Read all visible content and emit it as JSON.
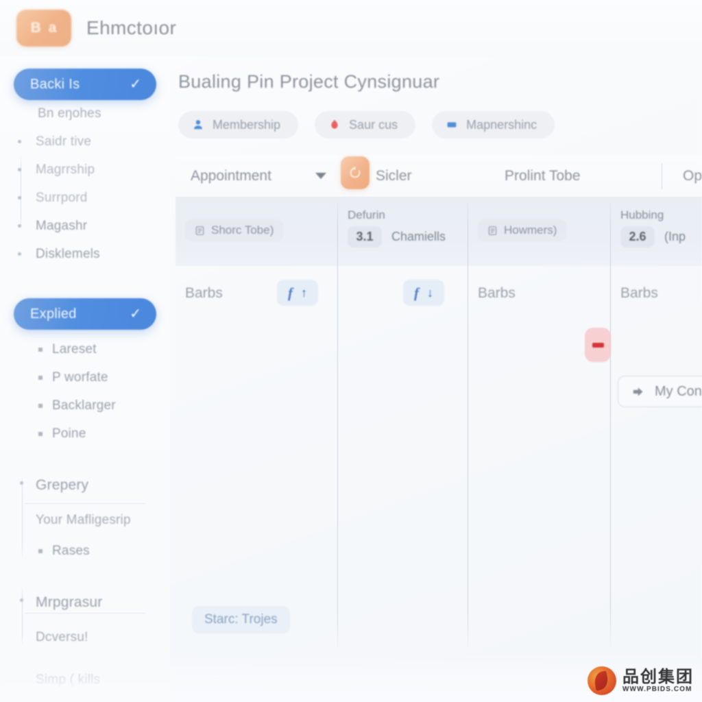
{
  "app": {
    "logo_glyph_left": "B",
    "logo_glyph_right": "a",
    "title": "Ehmctoıor",
    "accent_orange": "#f0b288",
    "accent_blue": "#4f8de0",
    "danger_red": "#d4343b"
  },
  "sidebar": {
    "group_backlis": {
      "label": "Backi Is",
      "check": "✓",
      "subtitle": "Bn eŋohes",
      "items": [
        {
          "label": "Saidr tive",
          "marker": "dot",
          "dim": true
        },
        {
          "label": "Magrrship",
          "marker": "dot",
          "dim": true
        },
        {
          "label": "Surrpord",
          "marker": "dot",
          "dim": true
        },
        {
          "label": "Magashr",
          "marker": "dot",
          "dim": false
        },
        {
          "label": "Disklemels",
          "marker": "dot",
          "dim": false
        }
      ]
    },
    "group_explied": {
      "label": "Explied",
      "check": "✓",
      "items": [
        {
          "label": "Lareset",
          "marker": "square"
        },
        {
          "label": "P worfate",
          "marker": "square"
        },
        {
          "label": "Backlarger",
          "marker": "square"
        },
        {
          "label": "Poine",
          "marker": "square"
        }
      ]
    },
    "group_grepery": {
      "label": "Grepery",
      "caption": "Your Mafligesrip",
      "items": [
        {
          "label": "Rases",
          "marker": "square"
        }
      ]
    },
    "group_mrpgrasur": {
      "label": "Mrpgrasur",
      "items": [
        {
          "label": "Dcversu!"
        }
      ]
    },
    "footer_item": "Simp ( kills"
  },
  "main": {
    "page_title": "Bualing Pin Project Cynsignuar",
    "chips": [
      {
        "label": "Membership",
        "icon": "person-icon"
      },
      {
        "label": "Saur cus",
        "icon": "flame-icon"
      },
      {
        "label": "Mapnershinc",
        "icon": "rectangle-icon"
      }
    ],
    "toolbar": {
      "select_value": "Appointment",
      "caret": "▼",
      "refresh_icon": "refresh-icon",
      "sicler_label": "Sicler",
      "prolint_label": "Prolint Tobe",
      "oplu_label": "Oplu"
    },
    "columns": [
      {
        "type": "chip",
        "header": "Shorc Tobe)",
        "icon": "list-icon",
        "row_label": "Barbs",
        "tag": {
          "mark": "f",
          "arrow": "↑"
        }
      },
      {
        "type": "stack",
        "header_top": "Defurin",
        "badge": "3.1",
        "header_side": "Chamiells",
        "row_label": "",
        "tag": {
          "mark": "f",
          "arrow": "↓"
        },
        "minus_button": "minus-icon"
      },
      {
        "type": "chip",
        "header": "Howmers)",
        "icon": "list-icon",
        "row_label": "Barbs"
      },
      {
        "type": "stack",
        "header_top": "Hubbing",
        "badge": "2.6",
        "header_side": "(Inp",
        "row_label": "Barbs",
        "button": {
          "label": "My Con",
          "icon": "arrow-right-icon"
        }
      }
    ],
    "status_chip": "Starc: Trojes"
  },
  "watermark": {
    "cn": "品创集团",
    "url": "WWW.PBIDS.COM"
  }
}
